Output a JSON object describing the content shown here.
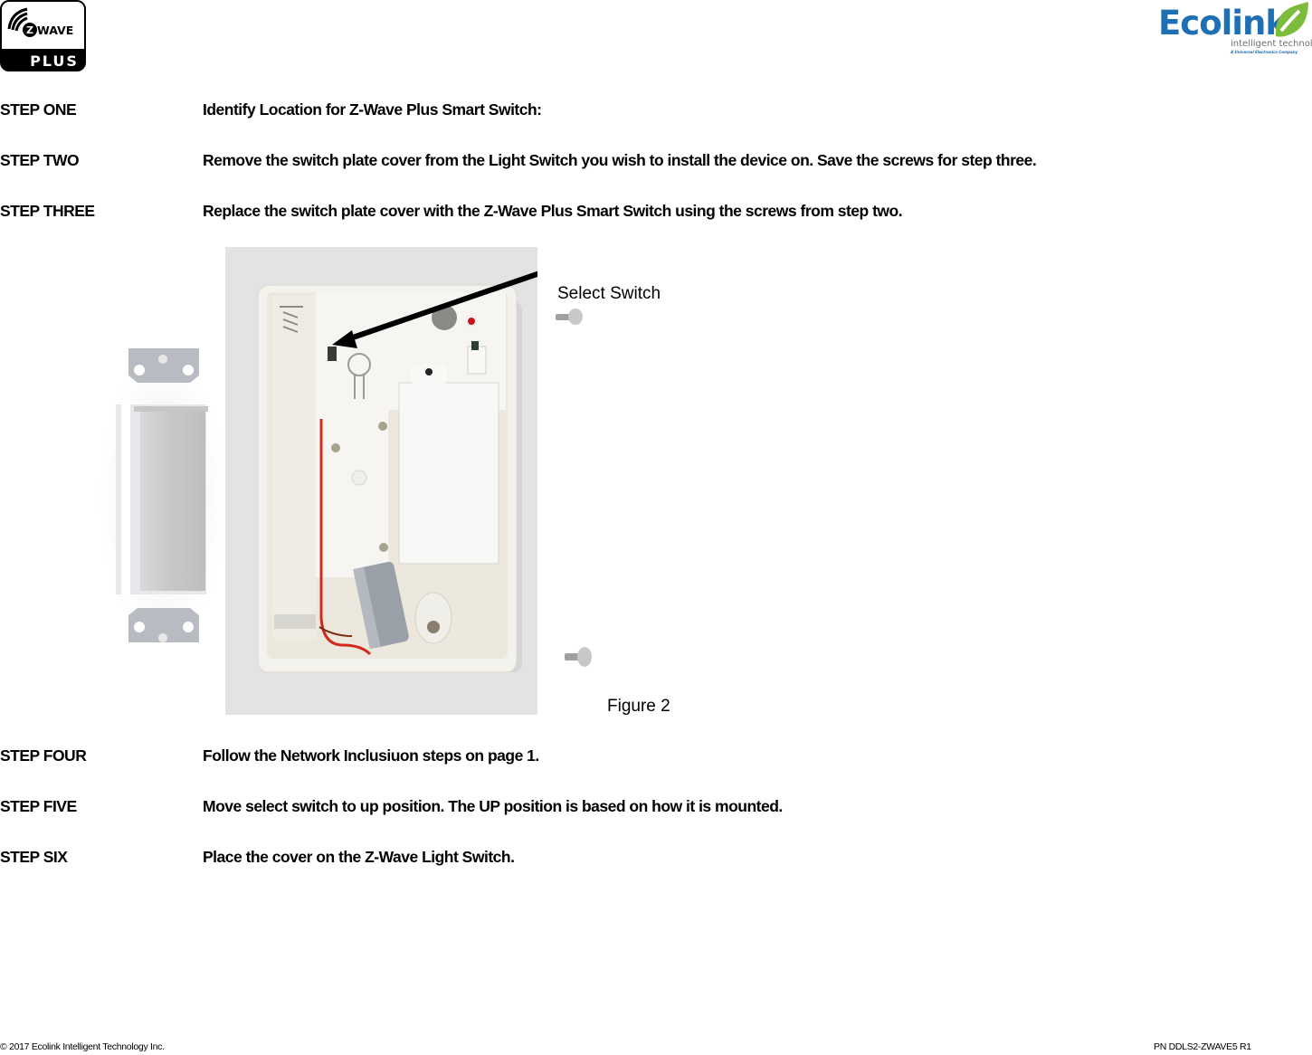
{
  "header": {
    "left_logo": {
      "icon": "zwave-plus-logo",
      "text_top": "WAVE",
      "text_badge": "Z",
      "text_bottom": "PLUS"
    },
    "right_logo": {
      "icon": "ecolink-logo",
      "wordmark": "Ecolink",
      "tagline": "intelligent technology",
      "subtag": "A Universal Electronics Company",
      "brand_color": "#1f6fb5",
      "leaf_color": "#7dbb3c"
    }
  },
  "steps_top": [
    {
      "label": "STEP ONE",
      "text": "Identify Location for Z-Wave Plus Smart Switch:"
    },
    {
      "label": "STEP TWO",
      "text": "Remove the switch plate cover from the Light Switch you wish to install the device on. Save the screws for step three."
    },
    {
      "label": "STEP THREE",
      "text": "Replace the switch plate cover with the Z-Wave Plus Smart Switch using the screws from step two."
    }
  ],
  "figure": {
    "callout": "Select Switch",
    "caption": "Figure 2",
    "images": [
      "decora-light-switch-render",
      "opened-smart-switch-photo",
      "mounting-screw",
      "mounting-screw"
    ],
    "accent_colors": {
      "wire_red": "#d42a1e",
      "led_red": "#c8141a",
      "arrow": "#000000"
    }
  },
  "steps_bottom": [
    {
      "label": "STEP FOUR",
      "text": "Follow the Network Inclusiuon steps on page 1."
    },
    {
      "label": "STEP FIVE",
      "text": "Move select switch to up position.  The UP position is based on how it is mounted."
    },
    {
      "label": "STEP SIX",
      "text": "Place the cover on the Z-Wave Light Switch."
    }
  ],
  "footer": {
    "copyright": "© 2017 Ecolink Intelligent Technology Inc.",
    "part_number": "PN DDLS2-ZWAVE5 R1"
  }
}
